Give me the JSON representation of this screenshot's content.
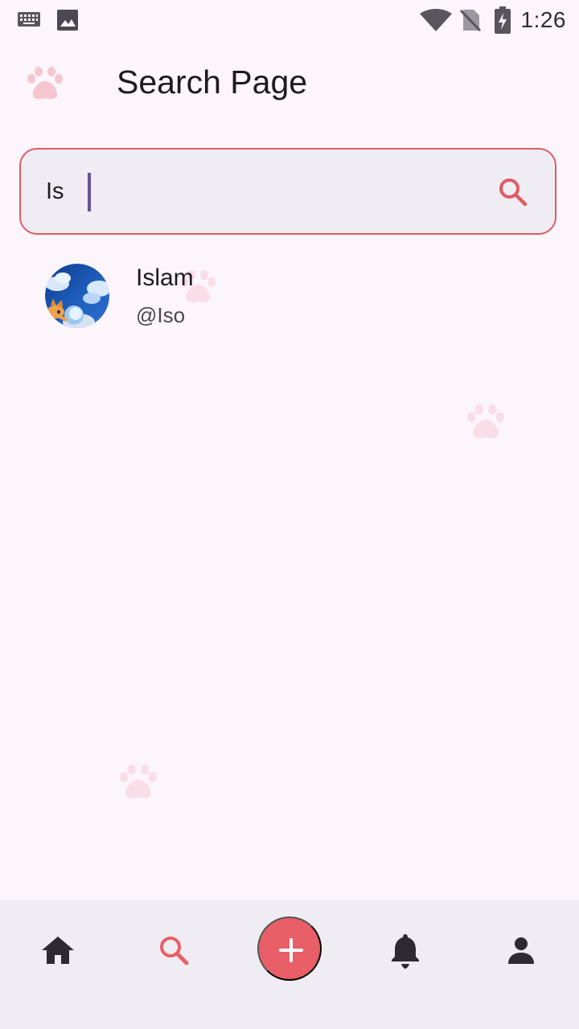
{
  "status_bar": {
    "time": "1:26",
    "icons": [
      "keyboard-icon",
      "image-icon",
      "wifi-icon",
      "no-sim-icon",
      "battery-charging-icon"
    ]
  },
  "app_bar": {
    "logo_icon": "paw-logo-icon",
    "title": "Search Page"
  },
  "search": {
    "value": "Is",
    "icon": "search-icon",
    "accent_color": "#e05b65",
    "caret_color": "#6750a4"
  },
  "results": [
    {
      "name": "Islam",
      "handle": "@Iso",
      "avatar": "cat-in-clouds-avatar"
    }
  ],
  "bottom_nav": {
    "items": [
      "home-icon",
      "search-icon",
      "add-icon",
      "notifications-icon",
      "profile-icon"
    ],
    "active_color": "#e95f67",
    "inactive_color": "#2d2b31"
  }
}
